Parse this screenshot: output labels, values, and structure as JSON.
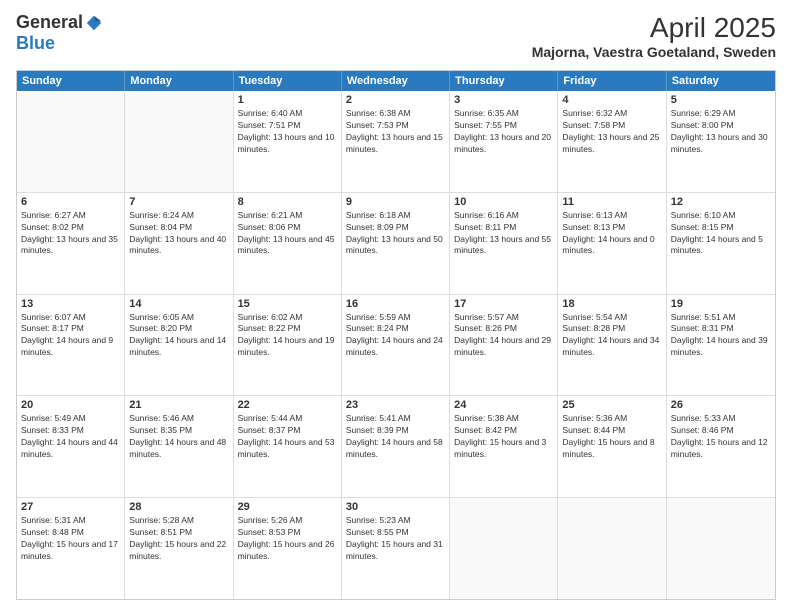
{
  "logo": {
    "general": "General",
    "blue": "Blue"
  },
  "title": "April 2025",
  "subtitle": "Majorna, Vaestra Goetaland, Sweden",
  "headers": [
    "Sunday",
    "Monday",
    "Tuesday",
    "Wednesday",
    "Thursday",
    "Friday",
    "Saturday"
  ],
  "rows": [
    [
      {
        "day": "",
        "info": ""
      },
      {
        "day": "",
        "info": ""
      },
      {
        "day": "1",
        "info": "Sunrise: 6:40 AM\nSunset: 7:51 PM\nDaylight: 13 hours and 10 minutes."
      },
      {
        "day": "2",
        "info": "Sunrise: 6:38 AM\nSunset: 7:53 PM\nDaylight: 13 hours and 15 minutes."
      },
      {
        "day": "3",
        "info": "Sunrise: 6:35 AM\nSunset: 7:55 PM\nDaylight: 13 hours and 20 minutes."
      },
      {
        "day": "4",
        "info": "Sunrise: 6:32 AM\nSunset: 7:58 PM\nDaylight: 13 hours and 25 minutes."
      },
      {
        "day": "5",
        "info": "Sunrise: 6:29 AM\nSunset: 8:00 PM\nDaylight: 13 hours and 30 minutes."
      }
    ],
    [
      {
        "day": "6",
        "info": "Sunrise: 6:27 AM\nSunset: 8:02 PM\nDaylight: 13 hours and 35 minutes."
      },
      {
        "day": "7",
        "info": "Sunrise: 6:24 AM\nSunset: 8:04 PM\nDaylight: 13 hours and 40 minutes."
      },
      {
        "day": "8",
        "info": "Sunrise: 6:21 AM\nSunset: 8:06 PM\nDaylight: 13 hours and 45 minutes."
      },
      {
        "day": "9",
        "info": "Sunrise: 6:18 AM\nSunset: 8:09 PM\nDaylight: 13 hours and 50 minutes."
      },
      {
        "day": "10",
        "info": "Sunrise: 6:16 AM\nSunset: 8:11 PM\nDaylight: 13 hours and 55 minutes."
      },
      {
        "day": "11",
        "info": "Sunrise: 6:13 AM\nSunset: 8:13 PM\nDaylight: 14 hours and 0 minutes."
      },
      {
        "day": "12",
        "info": "Sunrise: 6:10 AM\nSunset: 8:15 PM\nDaylight: 14 hours and 5 minutes."
      }
    ],
    [
      {
        "day": "13",
        "info": "Sunrise: 6:07 AM\nSunset: 8:17 PM\nDaylight: 14 hours and 9 minutes."
      },
      {
        "day": "14",
        "info": "Sunrise: 6:05 AM\nSunset: 8:20 PM\nDaylight: 14 hours and 14 minutes."
      },
      {
        "day": "15",
        "info": "Sunrise: 6:02 AM\nSunset: 8:22 PM\nDaylight: 14 hours and 19 minutes."
      },
      {
        "day": "16",
        "info": "Sunrise: 5:59 AM\nSunset: 8:24 PM\nDaylight: 14 hours and 24 minutes."
      },
      {
        "day": "17",
        "info": "Sunrise: 5:57 AM\nSunset: 8:26 PM\nDaylight: 14 hours and 29 minutes."
      },
      {
        "day": "18",
        "info": "Sunrise: 5:54 AM\nSunset: 8:28 PM\nDaylight: 14 hours and 34 minutes."
      },
      {
        "day": "19",
        "info": "Sunrise: 5:51 AM\nSunset: 8:31 PM\nDaylight: 14 hours and 39 minutes."
      }
    ],
    [
      {
        "day": "20",
        "info": "Sunrise: 5:49 AM\nSunset: 8:33 PM\nDaylight: 14 hours and 44 minutes."
      },
      {
        "day": "21",
        "info": "Sunrise: 5:46 AM\nSunset: 8:35 PM\nDaylight: 14 hours and 48 minutes."
      },
      {
        "day": "22",
        "info": "Sunrise: 5:44 AM\nSunset: 8:37 PM\nDaylight: 14 hours and 53 minutes."
      },
      {
        "day": "23",
        "info": "Sunrise: 5:41 AM\nSunset: 8:39 PM\nDaylight: 14 hours and 58 minutes."
      },
      {
        "day": "24",
        "info": "Sunrise: 5:38 AM\nSunset: 8:42 PM\nDaylight: 15 hours and 3 minutes."
      },
      {
        "day": "25",
        "info": "Sunrise: 5:36 AM\nSunset: 8:44 PM\nDaylight: 15 hours and 8 minutes."
      },
      {
        "day": "26",
        "info": "Sunrise: 5:33 AM\nSunset: 8:46 PM\nDaylight: 15 hours and 12 minutes."
      }
    ],
    [
      {
        "day": "27",
        "info": "Sunrise: 5:31 AM\nSunset: 8:48 PM\nDaylight: 15 hours and 17 minutes."
      },
      {
        "day": "28",
        "info": "Sunrise: 5:28 AM\nSunset: 8:51 PM\nDaylight: 15 hours and 22 minutes."
      },
      {
        "day": "29",
        "info": "Sunrise: 5:26 AM\nSunset: 8:53 PM\nDaylight: 15 hours and 26 minutes."
      },
      {
        "day": "30",
        "info": "Sunrise: 5:23 AM\nSunset: 8:55 PM\nDaylight: 15 hours and 31 minutes."
      },
      {
        "day": "",
        "info": ""
      },
      {
        "day": "",
        "info": ""
      },
      {
        "day": "",
        "info": ""
      }
    ]
  ]
}
